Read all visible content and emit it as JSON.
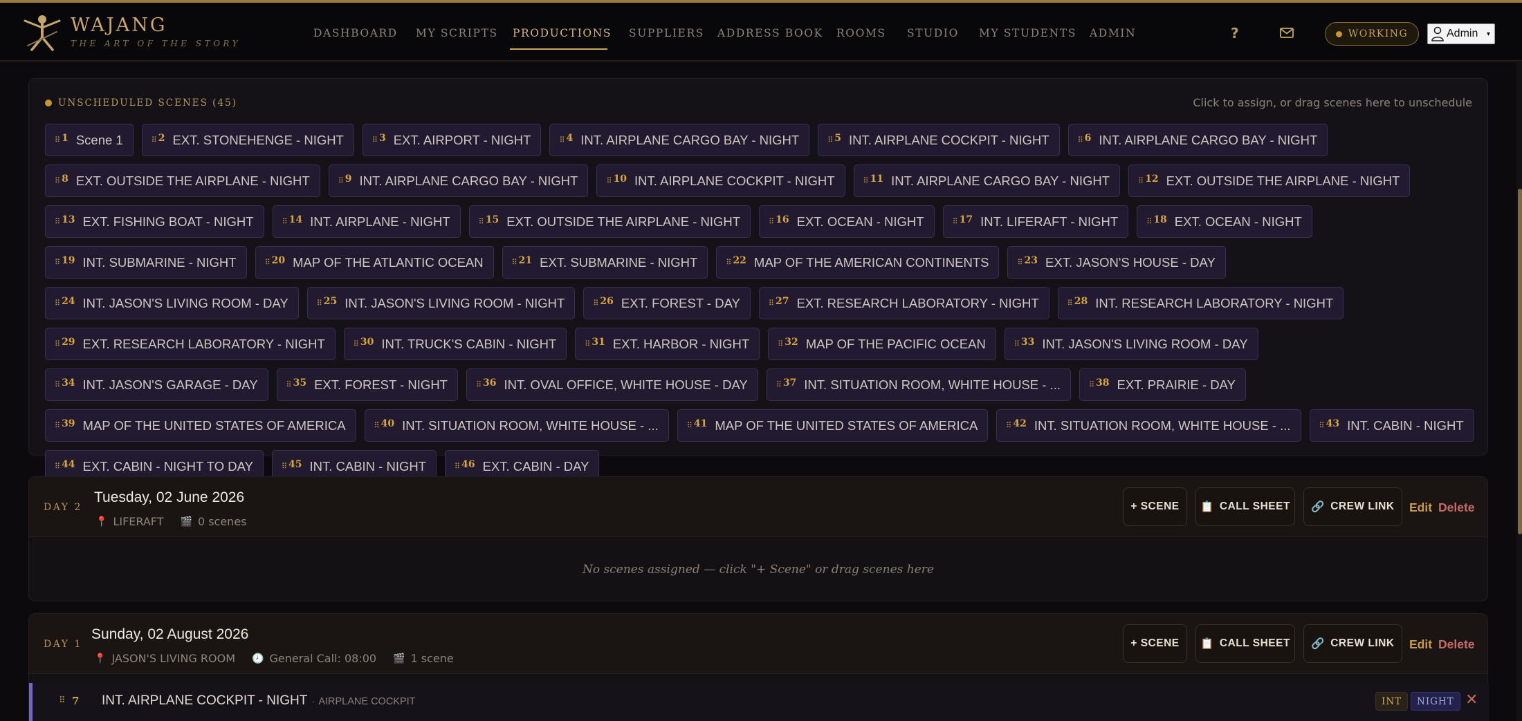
{
  "app": {
    "logo_name": "WAJANG",
    "logo_tagline": "THE ART OF THE STORY"
  },
  "nav": [
    {
      "label": "DASHBOARD",
      "active": false
    },
    {
      "label": "MY SCRIPTS",
      "active": false
    },
    {
      "label": "PRODUCTIONS",
      "active": true
    },
    {
      "label": "SUPPLIERS",
      "active": false
    },
    {
      "label": "ADDRESS BOOK",
      "active": false
    },
    {
      "label": "ROOMS",
      "active": false
    },
    {
      "label": "STUDIO",
      "active": false
    },
    {
      "label": "MY STUDENTS",
      "active": false
    },
    {
      "label": "ADMIN",
      "active": false
    }
  ],
  "header": {
    "help_label": "?",
    "status_label": "WORKING",
    "user_label": "Admin",
    "user_caret": "▾"
  },
  "unscheduled": {
    "title": "UNSCHEDULED SCENES (45)",
    "hint": "Click to assign, or drag scenes here to unschedule",
    "scenes": [
      {
        "num": "1",
        "label": "Scene 1"
      },
      {
        "num": "2",
        "label": "EXT. STONEHENGE - NIGHT"
      },
      {
        "num": "3",
        "label": "EXT. AIRPORT - NIGHT"
      },
      {
        "num": "4",
        "label": "INT. AIRPLANE CARGO BAY - NIGHT"
      },
      {
        "num": "5",
        "label": "INT. AIRPLANE COCKPIT - NIGHT"
      },
      {
        "num": "6",
        "label": "INT. AIRPLANE CARGO BAY - NIGHT"
      },
      {
        "num": "8",
        "label": "EXT. OUTSIDE THE AIRPLANE - NIGHT"
      },
      {
        "num": "9",
        "label": "INT. AIRPLANE CARGO BAY - NIGHT"
      },
      {
        "num": "10",
        "label": "INT. AIRPLANE COCKPIT - NIGHT"
      },
      {
        "num": "11",
        "label": "INT. AIRPLANE CARGO BAY - NIGHT"
      },
      {
        "num": "12",
        "label": "EXT. OUTSIDE THE AIRPLANE - NIGHT"
      },
      {
        "num": "13",
        "label": "EXT. FISHING BOAT - NIGHT"
      },
      {
        "num": "14",
        "label": "INT. AIRPLANE - NIGHT"
      },
      {
        "num": "15",
        "label": "EXT. OUTSIDE THE AIRPLANE - NIGHT"
      },
      {
        "num": "16",
        "label": "EXT. OCEAN - NIGHT"
      },
      {
        "num": "17",
        "label": "INT. LIFERAFT - NIGHT"
      },
      {
        "num": "18",
        "label": "EXT. OCEAN - NIGHT"
      },
      {
        "num": "19",
        "label": "INT. SUBMARINE - NIGHT"
      },
      {
        "num": "20",
        "label": "MAP OF THE ATLANTIC OCEAN"
      },
      {
        "num": "21",
        "label": "EXT. SUBMARINE - NIGHT"
      },
      {
        "num": "22",
        "label": "MAP OF THE AMERICAN CONTINENTS"
      },
      {
        "num": "23",
        "label": "EXT. JASON'S HOUSE - DAY"
      },
      {
        "num": "24",
        "label": "INT. JASON'S LIVING ROOM - DAY"
      },
      {
        "num": "25",
        "label": "INT. JASON'S LIVING ROOM - NIGHT"
      },
      {
        "num": "26",
        "label": "EXT. FOREST - DAY"
      },
      {
        "num": "27",
        "label": "EXT. RESEARCH LABORATORY - NIGHT"
      },
      {
        "num": "28",
        "label": "INT. RESEARCH LABORATORY - NIGHT"
      },
      {
        "num": "29",
        "label": "EXT. RESEARCH LABORATORY - NIGHT"
      },
      {
        "num": "30",
        "label": "INT. TRUCK'S CABIN - NIGHT"
      },
      {
        "num": "31",
        "label": "EXT. HARBOR - NIGHT"
      },
      {
        "num": "32",
        "label": "MAP OF THE PACIFIC OCEAN"
      },
      {
        "num": "33",
        "label": "INT. JASON'S LIVING ROOM - DAY"
      },
      {
        "num": "34",
        "label": "INT. JASON'S GARAGE - DAY"
      },
      {
        "num": "35",
        "label": "EXT. FOREST - NIGHT"
      },
      {
        "num": "36",
        "label": "INT. OVAL OFFICE, WHITE HOUSE - DAY"
      },
      {
        "num": "37",
        "label": "INT. SITUATION ROOM, WHITE HOUSE - ..."
      },
      {
        "num": "38",
        "label": "EXT. PRAIRIE - DAY"
      },
      {
        "num": "39",
        "label": "MAP OF THE UNITED STATES OF AMERICA"
      },
      {
        "num": "40",
        "label": "INT. SITUATION ROOM, WHITE HOUSE - ..."
      },
      {
        "num": "41",
        "label": "MAP OF THE UNITED STATES OF AMERICA"
      },
      {
        "num": "42",
        "label": "INT. SITUATION ROOM, WHITE HOUSE - ..."
      },
      {
        "num": "43",
        "label": "INT. CABIN - NIGHT"
      },
      {
        "num": "44",
        "label": "EXT. CABIN - NIGHT TO DAY"
      },
      {
        "num": "45",
        "label": "INT. CABIN - NIGHT"
      },
      {
        "num": "46",
        "label": "EXT. CABIN - DAY"
      }
    ]
  },
  "days": [
    {
      "label": "DAY 2",
      "date": "Tuesday, 02 June 2026",
      "location": "LIFERAFT",
      "scene_count": "0 scenes",
      "add_scene": "+ SCENE",
      "call_sheet": "CALL SHEET",
      "crew_link": "CREW LINK",
      "edit": "Edit",
      "delete": "Delete",
      "empty_message": "No scenes assigned — click \"+ Scene\" or drag scenes here"
    },
    {
      "label": "DAY 1",
      "date": "Sunday, 02 August 2026",
      "location": "JASON'S LIVING ROOM",
      "general_call": "General Call: 08:00",
      "scene_count": "1 scene",
      "add_scene": "+ SCENE",
      "call_sheet": "CALL SHEET",
      "crew_link": "CREW LINK",
      "edit": "Edit",
      "delete": "Delete",
      "scenes": [
        {
          "num": "7",
          "title": "INT. AIRPLANE COCKPIT - NIGHT",
          "separator": "·",
          "location": "AIRPLANE COCKPIT",
          "tag_int": "INT",
          "tag_time": "NIGHT"
        }
      ]
    }
  ],
  "colors": {
    "accent_gold": "#c9a767",
    "chip_bg": "#211a30",
    "delete_red": "#c66a6a",
    "scene_border": "#6f68c8"
  }
}
